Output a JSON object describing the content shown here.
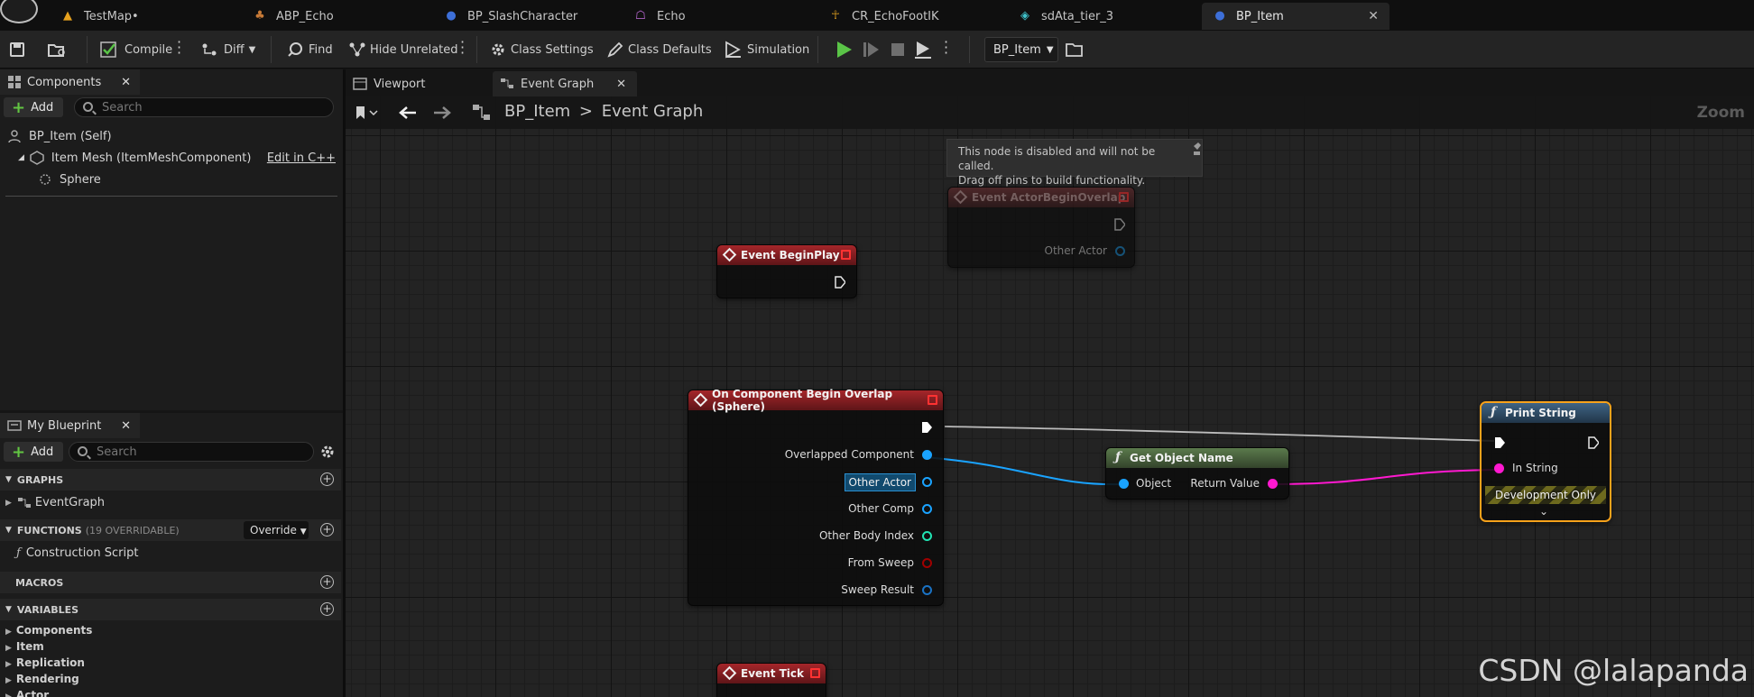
{
  "tabs": [
    {
      "label": "TestMap•",
      "icon": "level-icon"
    },
    {
      "label": "ABP_Echo",
      "icon": "anim-bp-icon"
    },
    {
      "label": "BP_SlashCharacter",
      "icon": "character-bp-icon"
    },
    {
      "label": "Echo",
      "icon": "skeleton-icon"
    },
    {
      "label": "CR_EchoFootIK",
      "icon": "control-rig-icon"
    },
    {
      "label": "sdAta_tier_3",
      "icon": "static-mesh-icon"
    },
    {
      "label": "BP_Item",
      "icon": "blueprint-icon",
      "active": true
    }
  ],
  "toolbar": {
    "compile": "Compile",
    "diff": "Diff",
    "find": "Find",
    "hide_unrelated": "Hide Unrelated",
    "class_settings": "Class Settings",
    "class_defaults": "Class Defaults",
    "simulation": "Simulation",
    "debug_object": "BP_Item"
  },
  "components": {
    "tab": "Components",
    "add": "Add",
    "search_placeholder": "Search",
    "self": "BP_Item (Self)",
    "mesh": "Item Mesh (ItemMeshComponent)",
    "edit_cpp": "Edit in C++",
    "sphere": "Sphere"
  },
  "my_blueprint": {
    "tab": "My Blueprint",
    "add": "Add",
    "search_placeholder": "Search",
    "graphs": "GRAPHS",
    "event_graph": "EventGraph",
    "functions": "FUNCTIONS",
    "functions_count": "(19 OVERRIDABLE)",
    "override": "Override",
    "construction_script": "Construction Script",
    "macros": "MACROS",
    "variables": "VARIABLES",
    "var_categories": [
      "Components",
      "Item",
      "Replication",
      "Rendering",
      "Actor"
    ]
  },
  "editor_tabs": {
    "viewport": "Viewport",
    "event_graph": "Event Graph"
  },
  "breadcrumb": {
    "root": "BP_Item",
    "sep": ">",
    "current": "Event Graph"
  },
  "zoom_label": "Zoom",
  "tooltip": {
    "line1": "This node is disabled and will not be called.",
    "line2": "Drag off pins to build functionality."
  },
  "nodes": {
    "actor_overlap": {
      "title": "Event ActorBeginOverlap",
      "pin": "Other Actor"
    },
    "begin_play": {
      "title": "Event BeginPlay"
    },
    "comp_overlap": {
      "title": "On Component Begin Overlap (Sphere)",
      "pins": [
        "Overlapped Component",
        "Other Actor",
        "Other Comp",
        "Other Body Index",
        "From Sweep",
        "Sweep Result"
      ]
    },
    "get_name": {
      "title": "Get Object Name",
      "in": "Object",
      "out": "Return Value"
    },
    "print": {
      "title": "Print String",
      "in": "In String",
      "dev": "Development Only"
    },
    "tick": {
      "title": "Event Tick"
    }
  },
  "watermark": "CSDN @lalapanda",
  "colors": {
    "exec": "#ffffff",
    "object": "#1aa3ff",
    "string": "#ff19d0",
    "bool": "#8c0000",
    "int": "#21e3b3",
    "selection": "#f7a21b"
  }
}
